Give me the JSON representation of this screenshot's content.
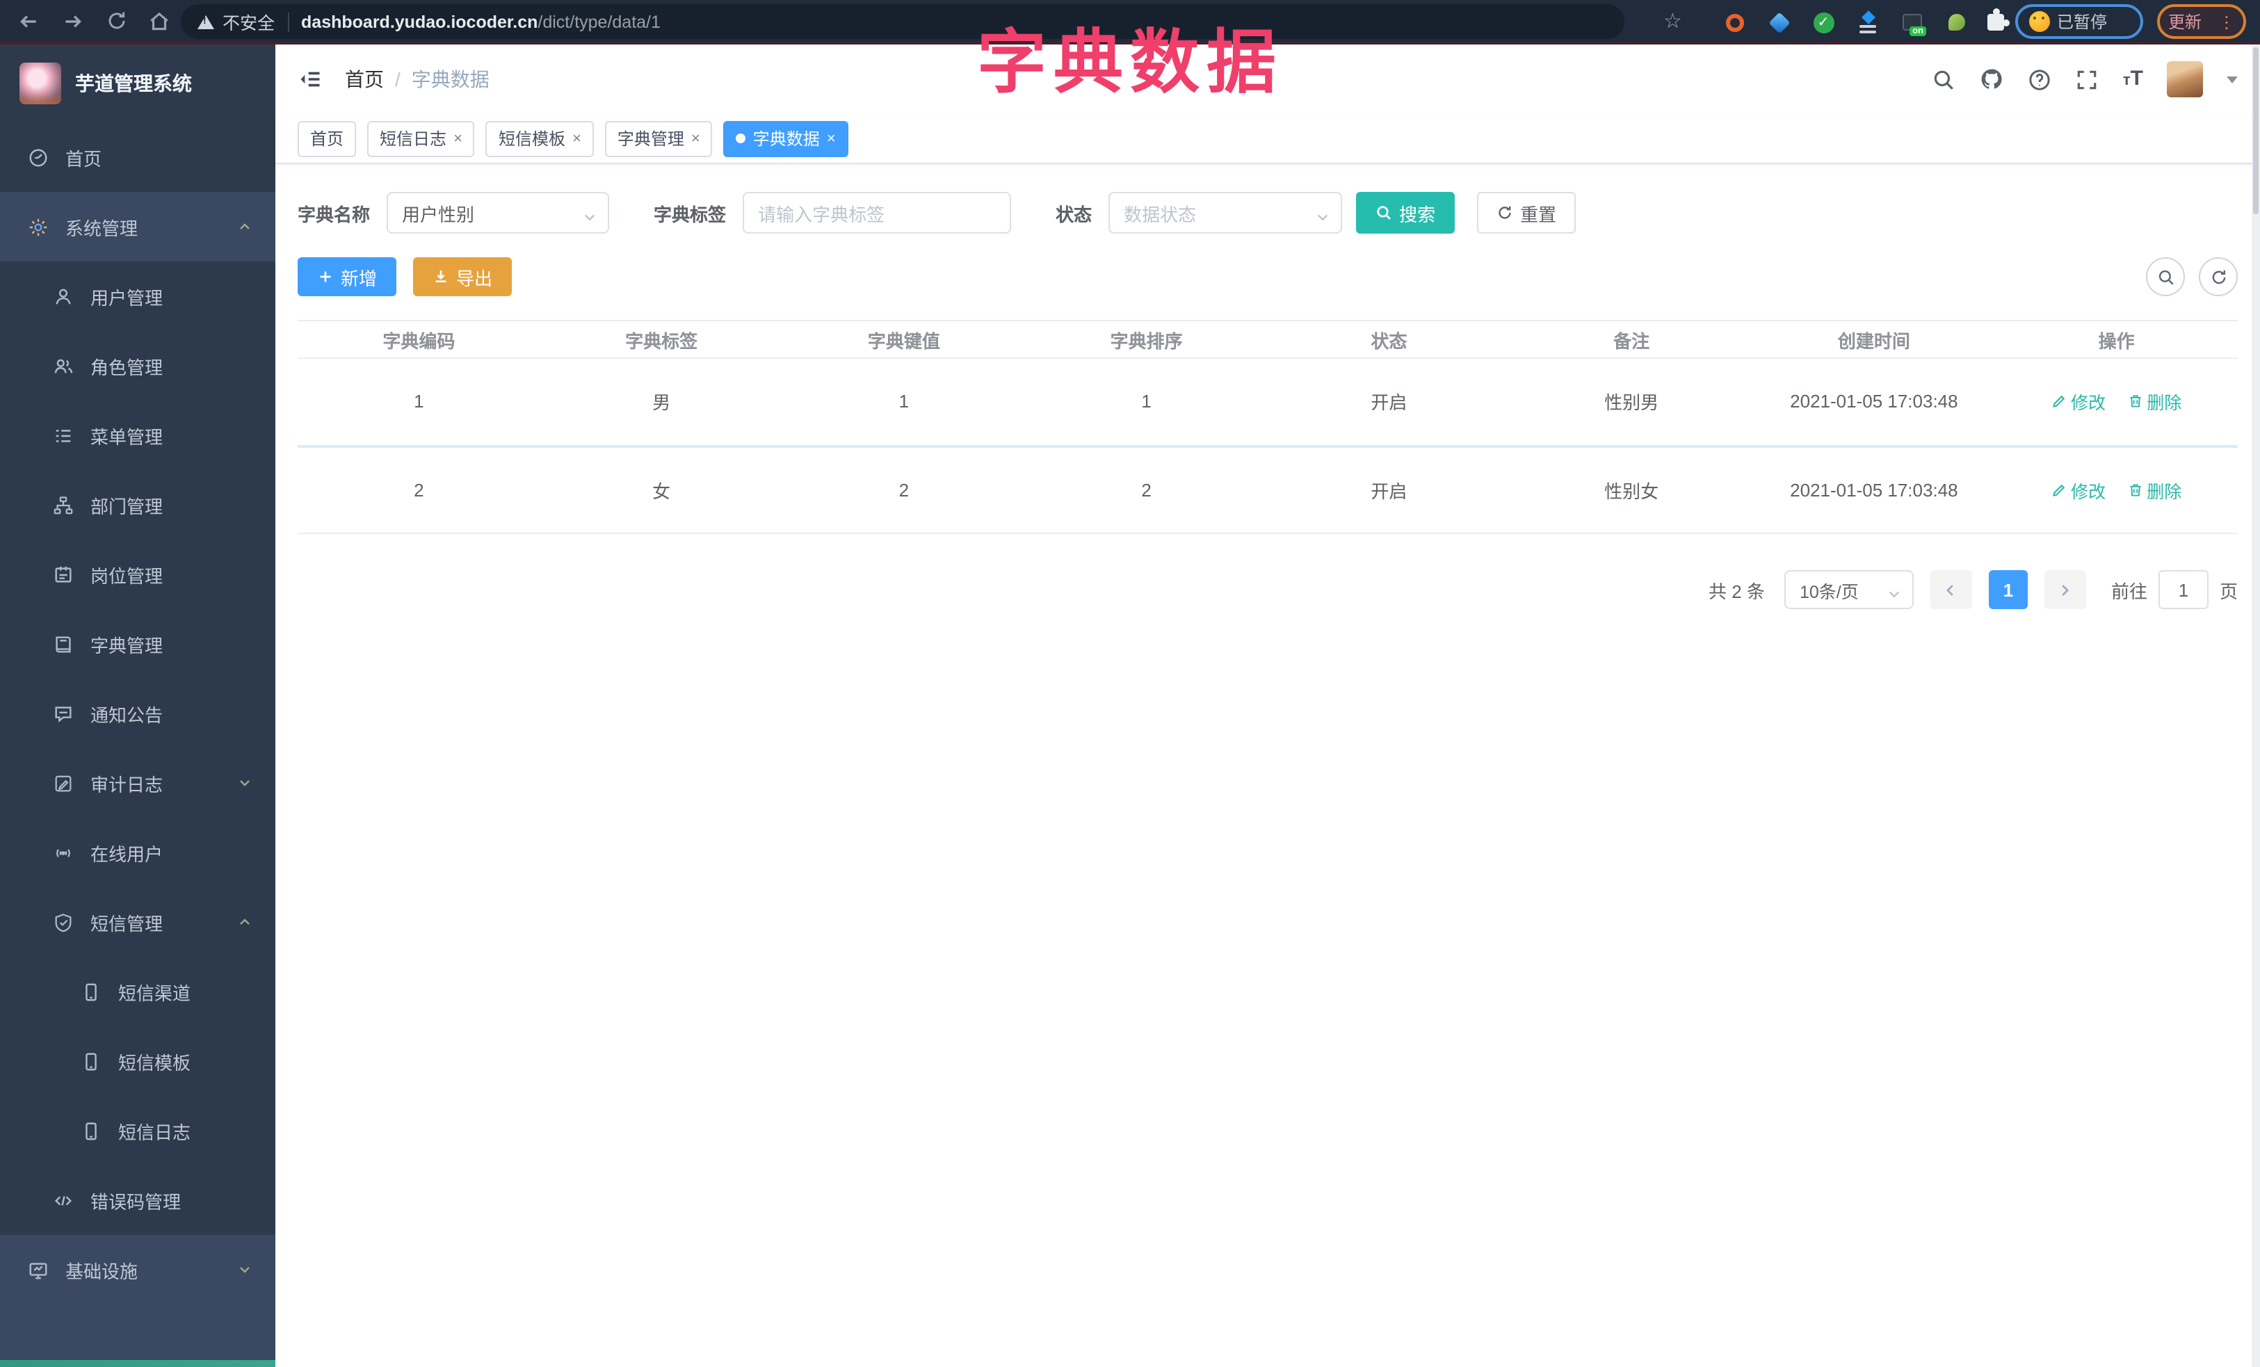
{
  "browser": {
    "security_label": "不安全",
    "url_host": "dashboard.yudao.iocoder.cn",
    "url_path": "/dict/type/data/1",
    "on_badge": "on",
    "paused_label": "已暂停",
    "update_label": "更新",
    "kebab": "⋮",
    "star": "☆"
  },
  "overlay_title": "字典数据",
  "sidebar": {
    "logo_title": "芋道管理系统",
    "items": [
      {
        "label": "首页",
        "icon": "dashboard-icon"
      },
      {
        "label": "系统管理",
        "icon": "gear-icon",
        "chevron": "up"
      },
      {
        "label": "用户管理",
        "icon": "user-icon"
      },
      {
        "label": "角色管理",
        "icon": "users-icon"
      },
      {
        "label": "菜单管理",
        "icon": "menu-list-icon"
      },
      {
        "label": "部门管理",
        "icon": "org-tree-icon"
      },
      {
        "label": "岗位管理",
        "icon": "badge-icon"
      },
      {
        "label": "字典管理",
        "icon": "dictionary-icon"
      },
      {
        "label": "通知公告",
        "icon": "announcement-icon"
      },
      {
        "label": "审计日志",
        "icon": "audit-log-icon",
        "chevron": "down"
      },
      {
        "label": "在线用户",
        "icon": "online-users-icon"
      },
      {
        "label": "短信管理",
        "icon": "shield-check-icon",
        "chevron": "up"
      },
      {
        "label": "短信渠道",
        "icon": "phone-icon"
      },
      {
        "label": "短信模板",
        "icon": "phone-icon"
      },
      {
        "label": "短信日志",
        "icon": "phone-icon"
      },
      {
        "label": "错误码管理",
        "icon": "code-icon"
      },
      {
        "label": "基础设施",
        "icon": "monitor-icon",
        "chevron": "down"
      }
    ]
  },
  "header": {
    "breadcrumb_home": "首页",
    "breadcrumb_sep": "/",
    "breadcrumb_current": "字典数据",
    "font_size_icon_small": "т",
    "font_size_icon_large": "T"
  },
  "tabs": [
    {
      "label": "首页"
    },
    {
      "label": "短信日志",
      "close": "×"
    },
    {
      "label": "短信模板",
      "close": "×"
    },
    {
      "label": "字典管理",
      "close": "×"
    },
    {
      "label": "字典数据",
      "close": "×",
      "active": true
    }
  ],
  "filters": {
    "name_label": "字典名称",
    "name_value": "用户性别",
    "tag_label": "字典标签",
    "tag_placeholder": "请输入字典标签",
    "status_label": "状态",
    "status_placeholder": "数据状态",
    "search_label": "搜索",
    "reset_label": "重置"
  },
  "toolbar": {
    "add_label": "新增",
    "export_label": "导出"
  },
  "table": {
    "headers": [
      "字典编码",
      "字典标签",
      "字典键值",
      "字典排序",
      "状态",
      "备注",
      "创建时间",
      "操作"
    ],
    "rows": [
      [
        "1",
        "男",
        "1",
        "1",
        "开启",
        "性别男",
        "2021-01-05 17:03:48"
      ],
      [
        "2",
        "女",
        "2",
        "2",
        "开启",
        "性别女",
        "2021-01-05 17:03:48"
      ]
    ],
    "edit_label": "修改",
    "delete_label": "删除"
  },
  "pagination": {
    "total_label": "共 2 条",
    "page_size": "10条/页",
    "current_page": "1",
    "goto_label": "前往",
    "goto_value": "1",
    "page_unit": "页"
  },
  "colors": {
    "accent_blue": "#409eff",
    "teal": "#27bdae",
    "warning_orange": "#e6a23c",
    "annotation_pink": "#ef3f6a",
    "sidebar_bg": "#2d3a4d"
  }
}
